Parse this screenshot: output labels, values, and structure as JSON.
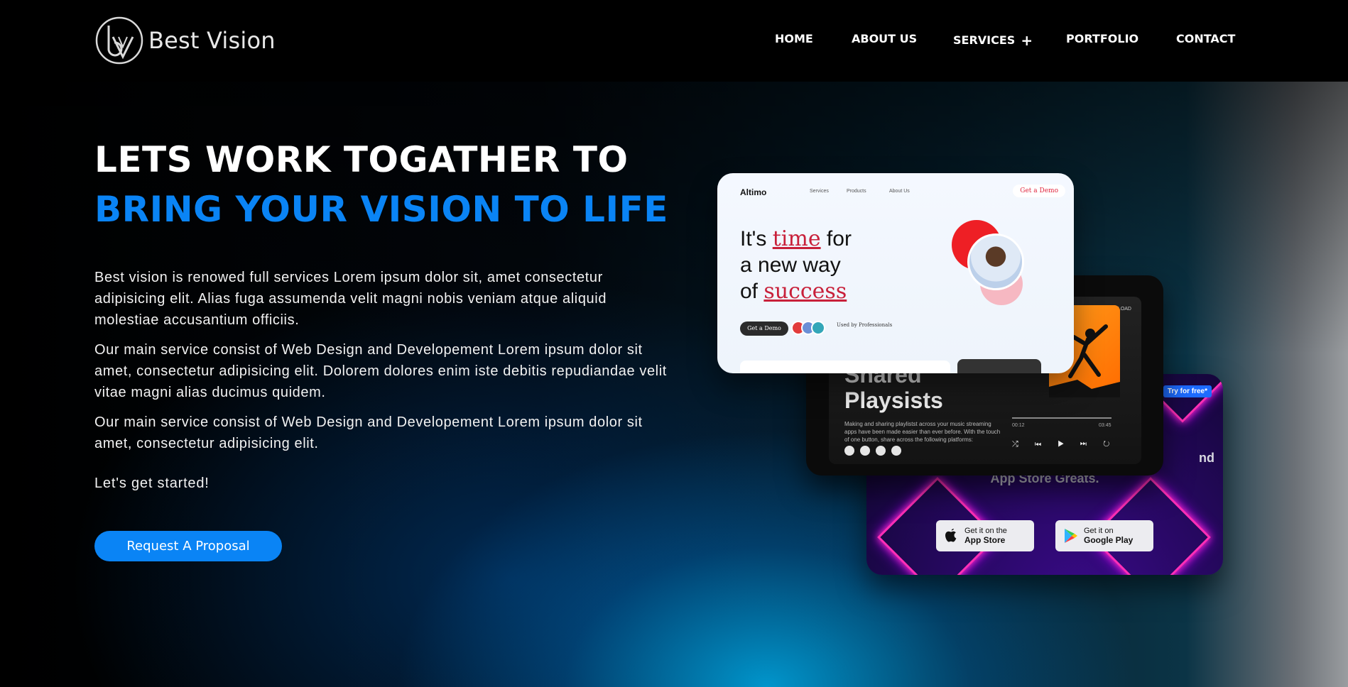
{
  "header": {
    "logo_text": "Best Vision",
    "nav": [
      {
        "label": "HOME"
      },
      {
        "label": "ABOUT US"
      },
      {
        "label": "SERVICES",
        "suffix": "+"
      },
      {
        "label": "PORTFOLIO"
      },
      {
        "label": "CONTACT"
      }
    ]
  },
  "hero": {
    "heading_line1": "LETS WORK TOGATHER TO",
    "heading_line2": "BRING YOUR VISION TO LIFE",
    "paragraphs": [
      "Best vision is renowed full services Lorem ipsum dolor sit, amet consectetur adipisicing elit. Alias fuga assumenda velit magni nobis veniam atque aliquid molestiae accusantium officiis.",
      "Our main service consist of Web Design and Developement Lorem ipsum dolor sit amet, consectetur adipisicing elit. Dolorem dolores enim iste debitis repudiandae velit vitae magni alias ducimus quidem.",
      "Our main service consist of Web Design and Developement Lorem ipsum dolor sit amet, consectetur adipisicing elit."
    ],
    "started": "Let's get started!",
    "cta_label": "Request A Proposal",
    "accent_color": "#0a84f5"
  },
  "mockups": {
    "web": {
      "brand": "Altimo",
      "links": [
        "Services",
        "Products",
        "About Us"
      ],
      "demo_top": "Get a Demo",
      "headline_a": "It's ",
      "headline_accent1": "time",
      "headline_b": " for",
      "headline_line2": "a new way",
      "headline_c": "of ",
      "headline_accent2": "success",
      "demo_button": "Get a Demo",
      "used_by": "Used by Professionals"
    },
    "music": {
      "download": "DOWNLOAD",
      "title1": "Shared",
      "title2": "Playsists",
      "desc": "Making and sharing playlistst across your music streaming apps have been made easier than ever before. With the touch of one button, share across the following platforms:",
      "time_start": "00:12",
      "time_end": "03:45",
      "controls": "⤮ ⏮ ▶ ⏭ ↻"
    },
    "app": {
      "try_free": "Try for free*",
      "partial_text": "nd",
      "subtitle": "App Store Greats.",
      "apple_small": "Get it on the",
      "apple_big": "App Store",
      "google_small": "Get it on",
      "google_big": "Google Play"
    }
  }
}
